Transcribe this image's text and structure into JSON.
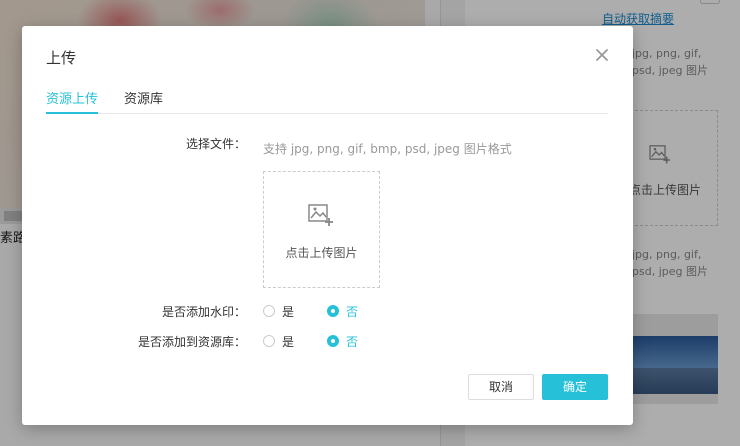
{
  "background": {
    "caption": "素路",
    "link_text": "自动获取摘要",
    "hint_lines_1": [
      "jpg, png, gif,",
      "psd, jpeg 图片"
    ],
    "hint_lines_2": [
      "jpg, png, gif,",
      "psd, jpeg 图片"
    ],
    "dropbox_text": "点击上传图片"
  },
  "modal": {
    "title": "上传",
    "tabs": [
      {
        "label": "资源上传",
        "active": true
      },
      {
        "label": "资源库",
        "active": false
      }
    ],
    "file_label": "选择文件：",
    "file_hint": "支持 jpg, png, gif, bmp, psd, jpeg 图片格式",
    "dropzone_text": "点击上传图片",
    "watermark": {
      "label": "是否添加水印：",
      "options": [
        "是",
        "否"
      ],
      "selected": "否"
    },
    "library": {
      "label": "是否添加到资源库：",
      "options": [
        "是",
        "否"
      ],
      "selected": "否"
    },
    "cancel_label": "取消",
    "ok_label": "确定"
  },
  "colors": {
    "accent": "#26c0d9",
    "overlay": "rgba(0,0,0,0.32)"
  }
}
